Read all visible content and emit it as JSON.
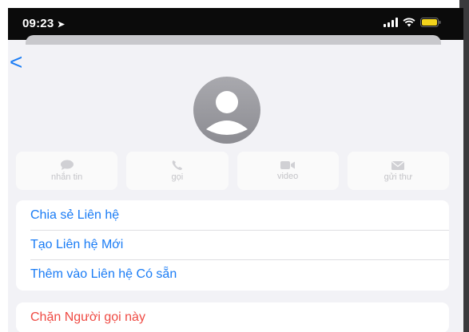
{
  "status_bar": {
    "time": "09:23",
    "location_icon": "location-arrow-icon",
    "signal_icon": "cellular-signal-icon",
    "wifi_icon": "wifi-icon",
    "battery_icon": "battery-icon",
    "battery_color": "#f2d31b"
  },
  "nav": {
    "back_label": "<"
  },
  "contact": {
    "avatar_icon": "person-avatar-icon"
  },
  "actions": [
    {
      "icon": "message-icon",
      "label": "nhắn tin"
    },
    {
      "icon": "phone-icon",
      "label": "gọi"
    },
    {
      "icon": "video-icon",
      "label": "video"
    },
    {
      "icon": "mail-icon",
      "label": "gửi thư"
    }
  ],
  "options": [
    {
      "label": "Chia sẻ Liên hệ"
    },
    {
      "label": "Tạo Liên hệ Mới"
    },
    {
      "label": "Thêm vào Liên hệ Có sẵn"
    }
  ],
  "block_option": {
    "label": "Chặn Người gọi này"
  },
  "colors": {
    "accent": "#1a7cf5",
    "danger": "#ef4a43",
    "background": "#f2f2f6"
  }
}
